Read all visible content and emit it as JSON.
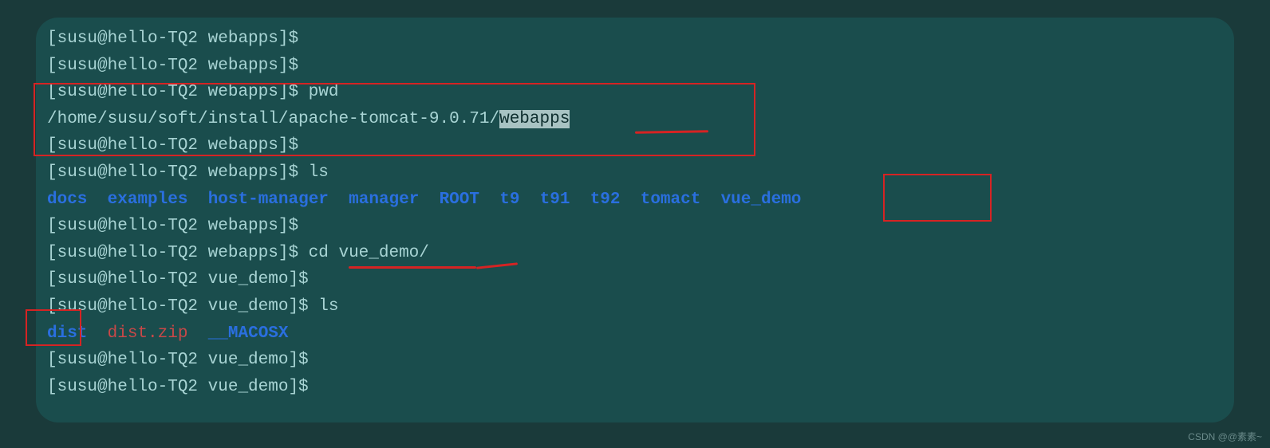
{
  "prompt": "[susu@hello-TQ2 webapps]$ ",
  "prompt_vue": "[susu@hello-TQ2 vue_demo]$ ",
  "cmd_pwd": "pwd",
  "pwd_out_prefix": "/home/susu/soft/install/apache-tomcat-9.0.71/",
  "pwd_out_sel": "webapps",
  "cmd_ls": "ls",
  "ls_webapps": {
    "docs": "docs",
    "examples": "examples",
    "host_manager": "host-manager",
    "manager": "manager",
    "root": "ROOT",
    "t9": "t9",
    "t91": "t91",
    "t92": "t92",
    "tomact": "tomact",
    "vue_demo": "vue_demo"
  },
  "cmd_cd": "cd vue_demo/",
  "ls_vuedemo": {
    "dist": "dist",
    "distzip": "dist.zip",
    "macosx": "__MACOSX"
  },
  "watermark": "CSDN @@素素~"
}
